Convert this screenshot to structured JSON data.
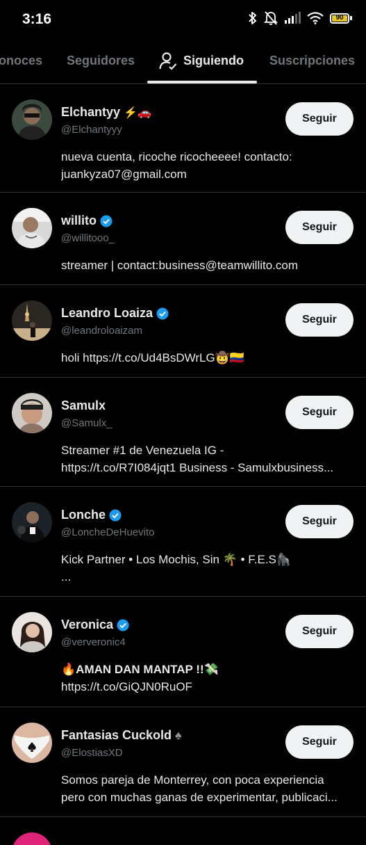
{
  "status": {
    "time": "3:16",
    "battery": "90"
  },
  "tabs": [
    "onoces",
    "Seguidores",
    "Siguiendo",
    "Suscripciones"
  ],
  "rows": [
    {
      "name": "Elchantyy",
      "emoji": "⚡🚗",
      "verified": false,
      "handle": "@Elchantyyy",
      "button": "Seguir",
      "bio": [
        "nueva cuenta, ricoche ricocheeee!   contacto:",
        "juankyza07@gmail.com"
      ]
    },
    {
      "name": "willito",
      "emoji": "",
      "verified": true,
      "handle": "@willitooo_",
      "button": "Seguir",
      "bio": [
        "streamer | contact:business@teamwillito.com"
      ]
    },
    {
      "name": "Leandro Loaiza",
      "emoji": "",
      "verified": true,
      "handle": "@leandroloaizam",
      "button": "Seguir",
      "bio": [
        "holi https://t.co/Ud4BsDWrLG🤠🇨🇴"
      ]
    },
    {
      "name": "Samulx",
      "emoji": "",
      "verified": false,
      "handle": "@Samulx_",
      "button": "Seguir",
      "bio": [
        "Streamer #1 de Venezuela IG -",
        "https://t.co/R7I084jqt1 Business - Samulxbusiness..."
      ]
    },
    {
      "name": "Lonche",
      "emoji": "",
      "verified": true,
      "handle": "@LoncheDeHuevito",
      "button": "Seguir",
      "bio": [
        "Kick Partner • Los Mochis, Sin 🌴 • F.E.S🦍",
        "..."
      ]
    },
    {
      "name": "Veronica",
      "emoji": "",
      "verified": true,
      "handle": "@ververonic4",
      "button": "Seguir",
      "bio": [
        "🔥AMAN DAN MANTAP !!💸",
        "https://t.co/GiQJN0RuOF"
      ]
    },
    {
      "name": "Fantasias Cuckold",
      "emoji": "♠",
      "verified": false,
      "handle": "@ElostiasXD",
      "button": "Seguir",
      "bio": [
        "Somos pareja de Monterrey, con poca experiencia",
        "pero con muchas ganas de experimentar, publicaci..."
      ]
    }
  ],
  "colors": {
    "background": "#000000",
    "divider": "#2f3336",
    "muted": "#71767b",
    "verified": "#1d9bf0",
    "button": "#eff3f4"
  }
}
